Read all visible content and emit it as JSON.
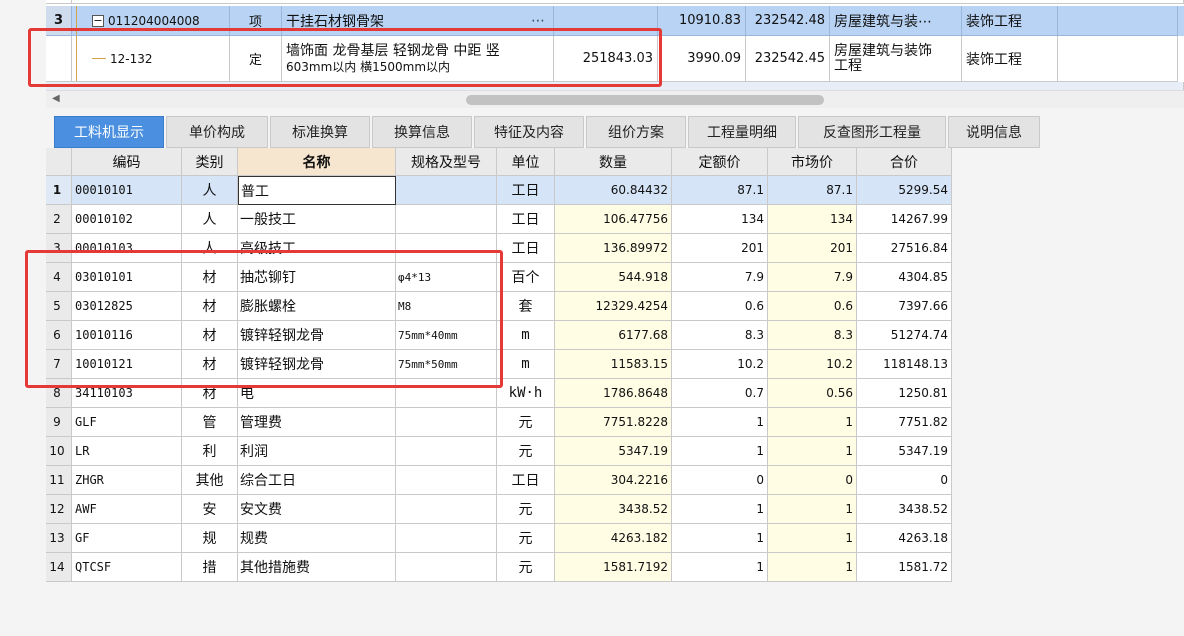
{
  "top_rows": [
    {
      "index": "3",
      "code": "011204004008",
      "type": "项",
      "name": "干挂石材钢骨架",
      "quantity": "",
      "unit_price": "10910.83",
      "total": "232542.48",
      "category": "房屋建筑与装⋯",
      "major": "装饰工程"
    },
    {
      "index": "",
      "code": "12-132",
      "type": "定",
      "name_line1": "墙饰面 龙骨基层 轻钢龙骨 中距 竖",
      "name_line2": "603mm以内 横1500mm以内",
      "quantity": "251843.03",
      "unit_price": "3990.09",
      "total": "232542.45",
      "category_line1": "房屋建筑与装饰",
      "category_line2": "工程",
      "major": "装饰工程"
    }
  ],
  "icons": {
    "expander": "minus-box-icon",
    "more": "ellipsis-icon",
    "scroll_left": "arrow-left-icon"
  },
  "tabs": [
    "工料机显示",
    "单价构成",
    "标准换算",
    "换算信息",
    "特征及内容",
    "组价方案",
    "工程量明细",
    "反查图形工程量",
    "说明信息"
  ],
  "columns": [
    "编码",
    "类别",
    "名称",
    "规格及型号",
    "单位",
    "数量",
    "定额价",
    "市场价",
    "合价"
  ],
  "rows": [
    {
      "i": "1",
      "code": "00010101",
      "cat": "人",
      "name": "普工",
      "spec": "",
      "unit": "工日",
      "qty": "60.84432",
      "price": "87.1",
      "market": "87.1",
      "total": "5299.54"
    },
    {
      "i": "2",
      "code": "00010102",
      "cat": "人",
      "name": "一般技工",
      "spec": "",
      "unit": "工日",
      "qty": "106.47756",
      "price": "134",
      "market": "134",
      "total": "14267.99"
    },
    {
      "i": "3",
      "code": "00010103",
      "cat": "人",
      "name": "高级技工",
      "spec": "",
      "unit": "工日",
      "qty": "136.89972",
      "price": "201",
      "market": "201",
      "total": "27516.84"
    },
    {
      "i": "4",
      "code": "03010101",
      "cat": "材",
      "name": "抽芯铆钉",
      "spec": "φ4*13",
      "unit": "百个",
      "qty": "544.918",
      "price": "7.9",
      "market": "7.9",
      "total": "4304.85"
    },
    {
      "i": "5",
      "code": "03012825",
      "cat": "材",
      "name": "膨胀螺栓",
      "spec": "M8",
      "unit": "套",
      "qty": "12329.4254",
      "price": "0.6",
      "market": "0.6",
      "total": "7397.66"
    },
    {
      "i": "6",
      "code": "10010116",
      "cat": "材",
      "name": "镀锌轻钢龙骨",
      "spec": "75mm*40mm",
      "unit": "m",
      "qty": "6177.68",
      "price": "8.3",
      "market": "8.3",
      "total": "51274.74"
    },
    {
      "i": "7",
      "code": "10010121",
      "cat": "材",
      "name": "镀锌轻钢龙骨",
      "spec": "75mm*50mm",
      "unit": "m",
      "qty": "11583.15",
      "price": "10.2",
      "market": "10.2",
      "total": "118148.13"
    },
    {
      "i": "8",
      "code": "34110103",
      "cat": "材",
      "name": "电",
      "spec": "",
      "unit": "kW·h",
      "qty": "1786.8648",
      "price": "0.7",
      "market": "0.56",
      "total": "1250.81"
    },
    {
      "i": "9",
      "code": "GLF",
      "cat": "管",
      "name": "管理费",
      "spec": "",
      "unit": "元",
      "qty": "7751.8228",
      "price": "1",
      "market": "1",
      "total": "7751.82"
    },
    {
      "i": "10",
      "code": "LR",
      "cat": "利",
      "name": "利润",
      "spec": "",
      "unit": "元",
      "qty": "5347.19",
      "price": "1",
      "market": "1",
      "total": "5347.19"
    },
    {
      "i": "11",
      "code": "ZHGR",
      "cat": "其他",
      "name": "综合工日",
      "spec": "",
      "unit": "工日",
      "qty": "304.2216",
      "price": "0",
      "market": "0",
      "total": "0"
    },
    {
      "i": "12",
      "code": "AWF",
      "cat": "安",
      "name": "安文费",
      "spec": "",
      "unit": "元",
      "qty": "3438.52",
      "price": "1",
      "market": "1",
      "total": "3438.52"
    },
    {
      "i": "13",
      "code": "GF",
      "cat": "规",
      "name": "规费",
      "spec": "",
      "unit": "元",
      "qty": "4263.182",
      "price": "1",
      "market": "1",
      "total": "4263.18"
    },
    {
      "i": "14",
      "code": "QTCSF",
      "cat": "措",
      "name": "其他措施费",
      "spec": "",
      "unit": "元",
      "qty": "1581.7192",
      "price": "1",
      "market": "1",
      "total": "1581.72"
    }
  ],
  "colors": {
    "accent": "#4a8fe0",
    "selected_row": "#b8d3f3",
    "highlight": "#e53935",
    "yellow_cell": "#fffde4"
  }
}
